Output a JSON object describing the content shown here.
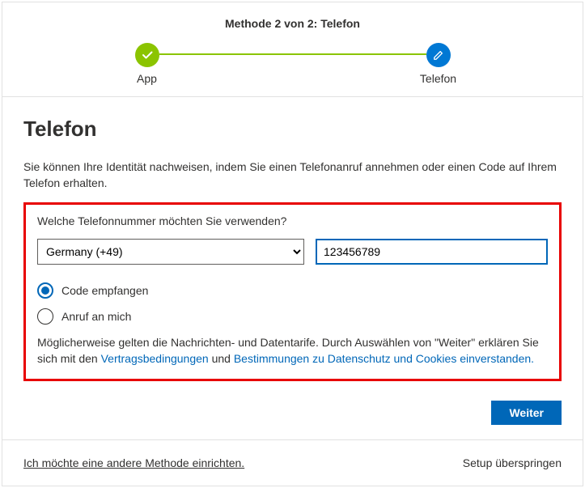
{
  "header": {
    "title": "Methode 2 von 2: Telefon",
    "steps": {
      "app": "App",
      "phone": "Telefon"
    }
  },
  "page": {
    "title": "Telefon",
    "intro": "Sie können Ihre Identität nachweisen, indem Sie einen Telefonanruf annehmen oder einen Code auf Ihrem Telefon erhalten.",
    "question": "Welche Telefonnummer möchten Sie verwenden?",
    "country_selected": "Germany (+49)",
    "phone_value": "123456789",
    "option_code": "Code empfangen",
    "option_call": "Anruf an mich",
    "selected_option": "code",
    "legal_prefix": "Möglicherweise gelten die Nachrichten- und Datentarife. Durch Auswählen von \"Weiter\" erklären Sie sich mit den ",
    "legal_terms": "Vertragsbedingungen",
    "legal_mid": " und ",
    "legal_privacy": "Bestimmungen zu Datenschutz und Cookies einverstanden.",
    "next_button": "Weiter"
  },
  "footer": {
    "alt_method": "Ich möchte eine andere Methode einrichten.",
    "skip": "Setup überspringen"
  }
}
